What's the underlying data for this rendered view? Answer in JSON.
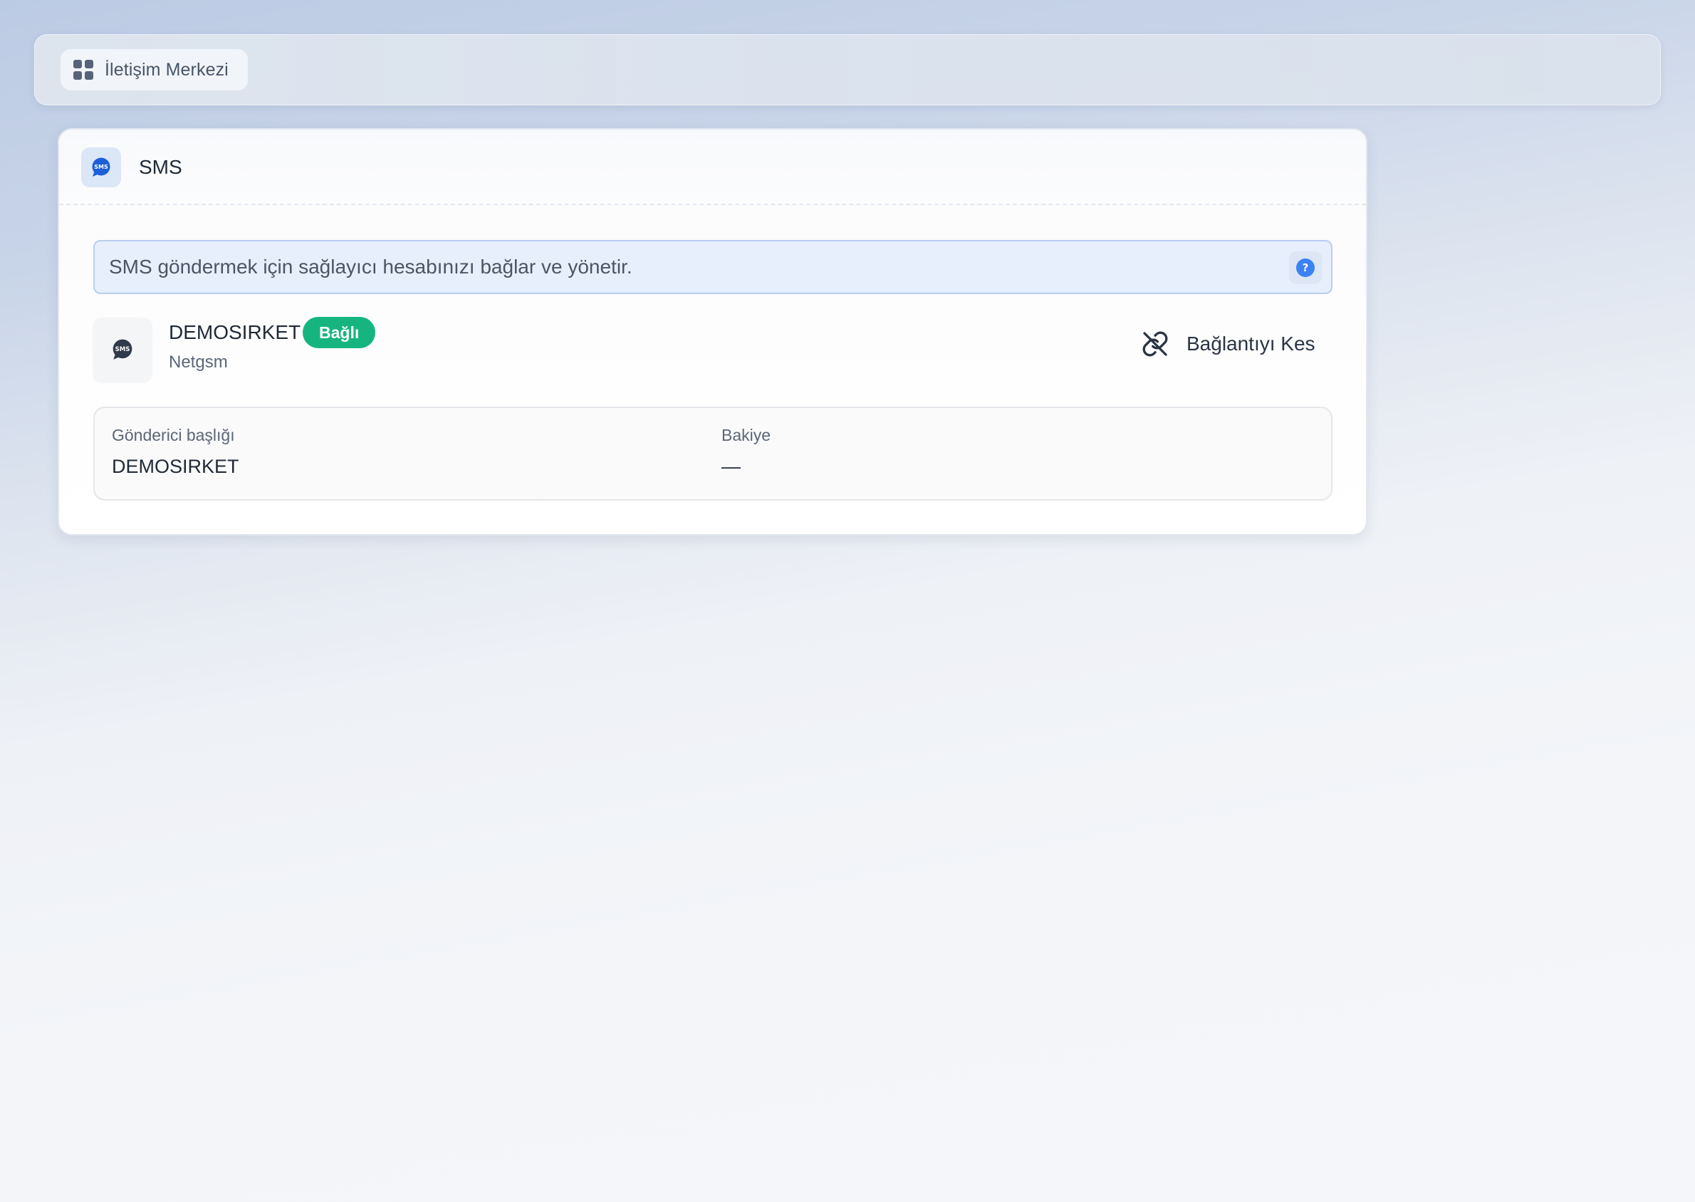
{
  "topbar": {
    "home_label": "İletişim Merkezi",
    "home_icon": "grid-icon"
  },
  "card": {
    "title": "SMS",
    "title_icon": "sms-bubble-icon",
    "info": {
      "text": "SMS göndermek için sağlayıcı hesabınızı bağlar ve yönetir.",
      "help_icon": "help-icon"
    },
    "provider": {
      "account_name": "DEMOSIRKET",
      "status": "Bağlı",
      "provider_name": "Netgsm",
      "icon": "sms-bubble-icon"
    },
    "disconnect": {
      "label": "Bağlantıyı Kes",
      "icon": "unlink-icon"
    },
    "details": {
      "sender_label": "Gönderici başlığı",
      "sender_value": "DEMOSIRKET",
      "balance_label": "Bakiye",
      "balance_value": "—"
    }
  },
  "colors": {
    "accent_blue": "#1d5fd6",
    "status_green": "#16b57f",
    "info_bg": "#e7effc",
    "info_border": "#b9cdef"
  }
}
